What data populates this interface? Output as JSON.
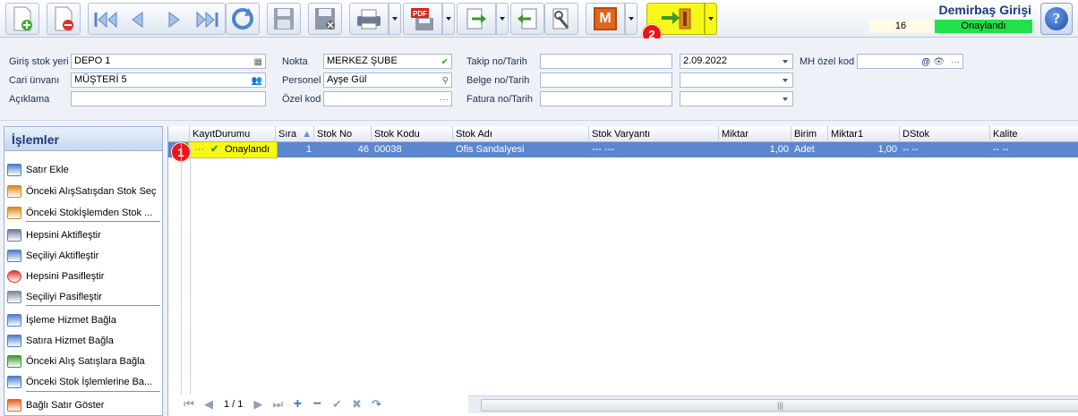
{
  "window": {
    "title": "Demirbaş Girişi",
    "doc_number": "16",
    "doc_status": "Onaylandı"
  },
  "colors": {
    "title": "#1c3a7a",
    "status_green": "#22e04a",
    "selected_row": "#5a87cf",
    "highlight_yellow": "#f7f71a",
    "badge_red": "#e81818"
  },
  "toolbar": {
    "icons": [
      "new-document-icon",
      "delete-document-icon",
      "first-record-icon",
      "previous-record-icon",
      "next-record-icon",
      "last-record-icon",
      "refresh-icon",
      "save-icon",
      "save-close-icon",
      "print-icon",
      "pdf-export-icon",
      "export-icon",
      "import-icon",
      "tools-icon",
      "m-icon",
      "approve-transfer-icon",
      "help-icon"
    ],
    "m_label": "M",
    "help_label": "?"
  },
  "badges": {
    "one": "1",
    "two": "2"
  },
  "form": {
    "giris_stok_yeri": {
      "label": "Giriş stok yeri",
      "value": "DEPO 1"
    },
    "cari_unvani": {
      "label": "Cari ünvanı",
      "value": "MÜŞTERİ 5"
    },
    "aciklama": {
      "label": "Açıklama",
      "value": ""
    },
    "nokta": {
      "label": "Nokta",
      "value": "MERKEZ ŞUBE"
    },
    "personel": {
      "label": "Personel",
      "value": "Ayşe Gül"
    },
    "ozel_kod": {
      "label": "Özel kod",
      "value": ""
    },
    "takip": {
      "label": "Takip no/Tarih",
      "value": "",
      "date": "2.09.2022"
    },
    "belge": {
      "label": "Belge no/Tarih",
      "value": "",
      "date": ""
    },
    "fatura": {
      "label": "Fatura no/Tarih",
      "value": "",
      "date": ""
    },
    "mh_ozel_kod": {
      "label": "MH özel kod",
      "value": ""
    },
    "ellipsis": "···"
  },
  "panel": {
    "title": "İşlemler",
    "items": [
      {
        "label": "Satır Ekle",
        "icon": "add-row-icon"
      },
      {
        "label": "Önceki AlışSatışdan Stok Seç",
        "icon": "select-from-purchase-icon"
      },
      {
        "label": "Önceki Stokİşlemden Stok ...",
        "icon": "select-from-stock-icon"
      },
      {
        "label": "Hepsini Aktifleştir",
        "icon": "activate-all-icon"
      },
      {
        "label": "Seçiliyi Aktifleştir",
        "icon": "activate-selected-icon"
      },
      {
        "label": "Hepsini Pasifleştir",
        "icon": "deactivate-all-icon"
      },
      {
        "label": "Seçiliyi Pasifleştir",
        "icon": "deactivate-selected-icon"
      },
      {
        "label": "İşleme Hizmet Bağla",
        "icon": "link-service-icon"
      },
      {
        "label": "Satıra Hizmet Bağla",
        "icon": "link-row-service-icon"
      },
      {
        "label": "Önceki Alış Satışlara Bağla",
        "icon": "link-purchase-icon"
      },
      {
        "label": "Önceki Stok İşlemlerine Ba...",
        "icon": "link-stock-icon"
      },
      {
        "label": "Bağlı Satır Göster",
        "icon": "show-linked-icon"
      }
    ]
  },
  "grid": {
    "columns": [
      "KayıtDurumu",
      "Sıra",
      "Stok No",
      "Stok Kodu",
      "Stok Adı",
      "Stok Varyantı",
      "Miktar",
      "Birim",
      "Miktar1",
      "DStok",
      "Kalite"
    ],
    "rows": [
      {
        "durum": "Onaylandı",
        "sira": "1",
        "stok_no": "46",
        "stok_kodu": "00038",
        "stok_adi": "Ofis Sandalyesi",
        "varyant": "--- ---",
        "miktar": "1,00",
        "birim": "Adet",
        "miktar1": "1,00",
        "dstok": "-- --",
        "kalite": "-- --"
      }
    ],
    "expand": "···",
    "pager": "1 / 1",
    "scroll_grip": "|||"
  }
}
